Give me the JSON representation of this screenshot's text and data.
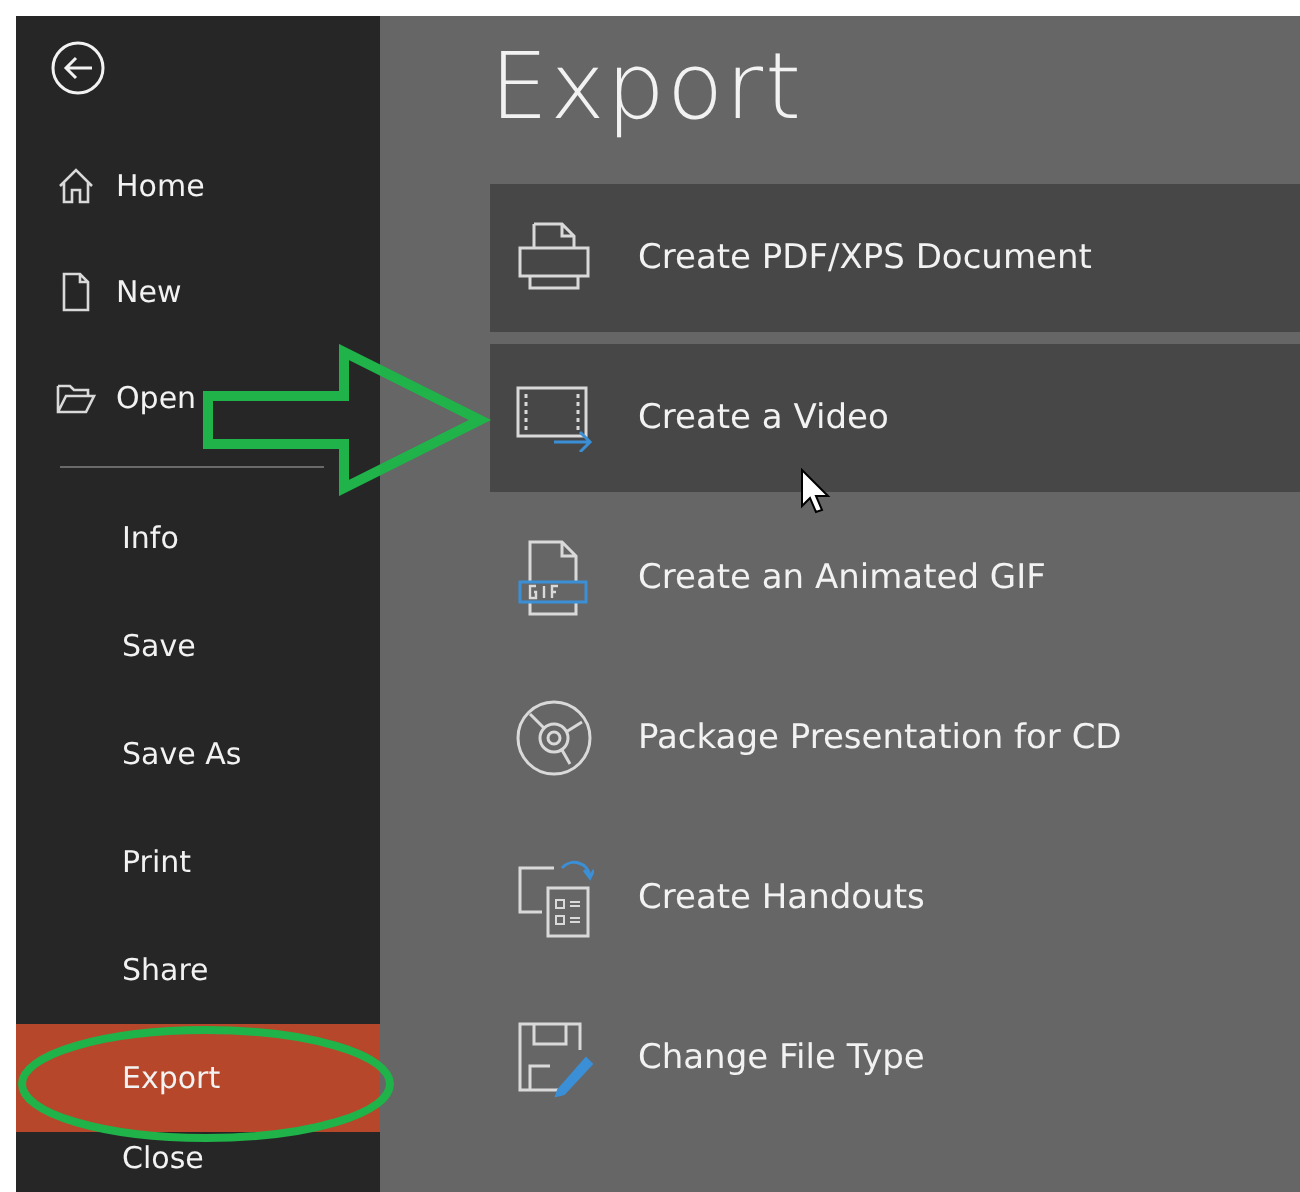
{
  "sidebar": {
    "top_items": [
      {
        "label": "Home"
      },
      {
        "label": "New"
      },
      {
        "label": "Open"
      }
    ],
    "items": [
      {
        "label": "Info",
        "selected": false
      },
      {
        "label": "Save",
        "selected": false
      },
      {
        "label": "Save As",
        "selected": false
      },
      {
        "label": "Print",
        "selected": false
      },
      {
        "label": "Share",
        "selected": false
      },
      {
        "label": "Export",
        "selected": true
      },
      {
        "label": "Close",
        "selected": false
      }
    ]
  },
  "title": "Export",
  "options": [
    {
      "label": "Create PDF/XPS Document",
      "highlighted": true
    },
    {
      "label": "Create a Video",
      "highlighted": true
    },
    {
      "label": "Create an Animated GIF",
      "highlighted": false
    },
    {
      "label": "Package Presentation for CD",
      "highlighted": false
    },
    {
      "label": "Create Handouts",
      "highlighted": false
    },
    {
      "label": "Change File Type",
      "highlighted": false
    }
  ]
}
